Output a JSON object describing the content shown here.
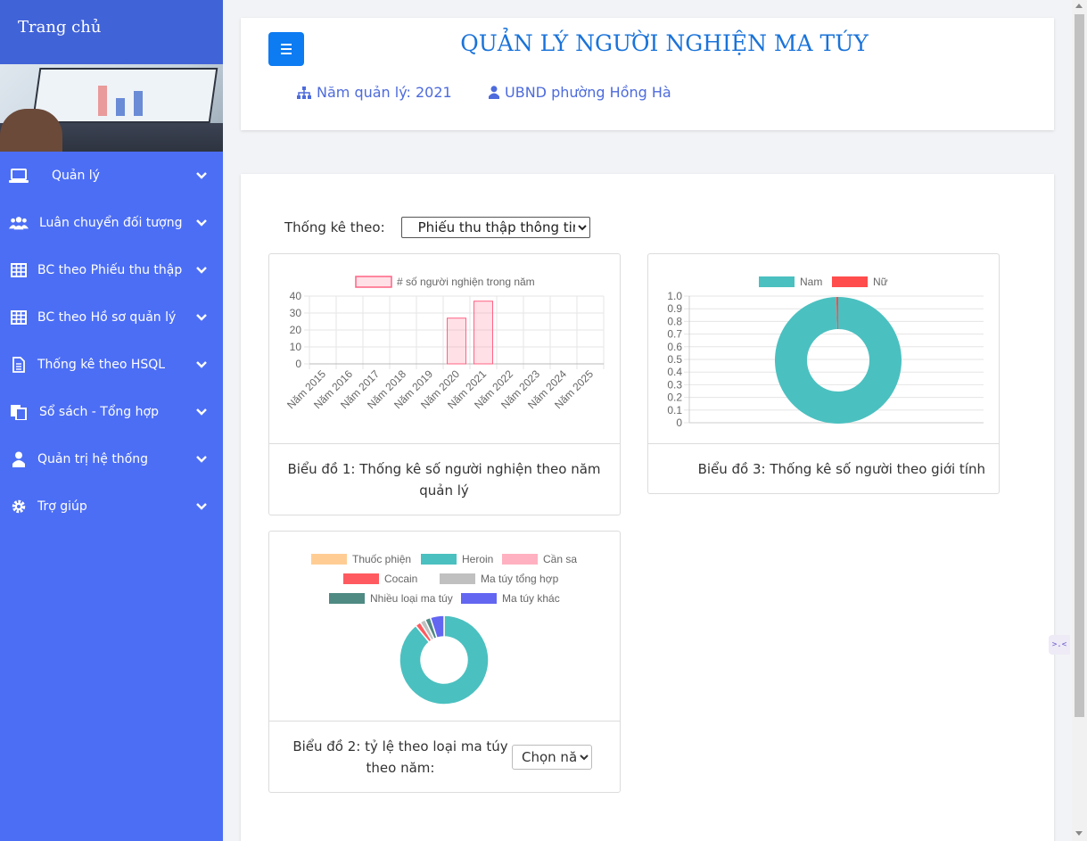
{
  "sidebar": {
    "title": "Trang chủ",
    "items": [
      {
        "label": "Quản lý",
        "icon": "laptop-icon"
      },
      {
        "label": "Luân chuyển đối tượng",
        "icon": "users-icon"
      },
      {
        "label": "BC theo Phiếu thu thập",
        "icon": "table-icon"
      },
      {
        "label": "BC theo Hồ sơ quản lý",
        "icon": "table-icon"
      },
      {
        "label": "Thống kê theo HSQL",
        "icon": "file-text-icon"
      },
      {
        "label": "Sổ sách - Tổng hợp",
        "icon": "copy-icon"
      },
      {
        "label": "Quản trị hệ thống",
        "icon": "user-icon"
      },
      {
        "label": "Trợ giúp",
        "icon": "gear-icon"
      }
    ]
  },
  "header": {
    "title": "QUẢN LÝ NGƯỜI NGHIỆN MA TÚY",
    "year_label": "Năm quản lý: 2021",
    "org_label": "UBND phường Hồng Hà",
    "accent_color": "#1a73d9"
  },
  "filter": {
    "label": "Thống kê theo:",
    "selected": "Phiếu thu thập thông tin"
  },
  "captions": {
    "chart1": "Biểu đồ 1: Thống kê số người nghiện theo năm quản lý",
    "chart3": "Biểu đồ 3: Thống kê số người theo giới tính",
    "chart2": "Biểu đồ 2: tỷ lệ theo loại ma túy theo năm:"
  },
  "year_select": {
    "selected": "Chọn năm"
  },
  "side_tab": ">.<",
  "chart_data": [
    {
      "type": "bar",
      "categories": [
        "Năm 2015",
        "Năm 2016",
        "Năm 2017",
        "Năm 2018",
        "Năm 2019",
        "Năm 2020",
        "Năm 2021",
        "Năm 2022",
        "Năm 2023",
        "Năm 2024",
        "Năm 2025"
      ],
      "series": [
        {
          "name": "# số người nghiện trong năm",
          "values": [
            0,
            0,
            0,
            0,
            0,
            27,
            37,
            0,
            0,
            0,
            0
          ],
          "color": "#ff6384"
        }
      ],
      "ylim": [
        0,
        40
      ],
      "yticks": [
        0,
        10,
        20,
        30,
        40
      ],
      "grid": true,
      "legend": "top"
    },
    {
      "type": "pie",
      "labels": [
        "Nam",
        "Nữ"
      ],
      "values": [
        99.5,
        0.5
      ],
      "colors": [
        "#4bc0c0",
        "#ff4c4c"
      ],
      "donut": true,
      "yticks": [
        "0",
        "0.1",
        "0.2",
        "0.3",
        "0.4",
        "0.5",
        "0.6",
        "0.7",
        "0.8",
        "0.9",
        "1.0"
      ],
      "grid": true,
      "legend": "top"
    },
    {
      "type": "pie",
      "labels": [
        "Thuốc phiện",
        "Heroin",
        "Cần sa",
        "Cocain",
        "Ma túy tổng hợp",
        "Nhiều loại ma túy",
        "Ma túy khác"
      ],
      "values": [
        0,
        89,
        0,
        2,
        2,
        2,
        5
      ],
      "colors": [
        "#ffcd94",
        "#4bc0c0",
        "#ffb1c1",
        "#ff5a5f",
        "#c0c0c0",
        "#4f8a83",
        "#6366f1"
      ],
      "donut": true,
      "legend": "top"
    }
  ]
}
